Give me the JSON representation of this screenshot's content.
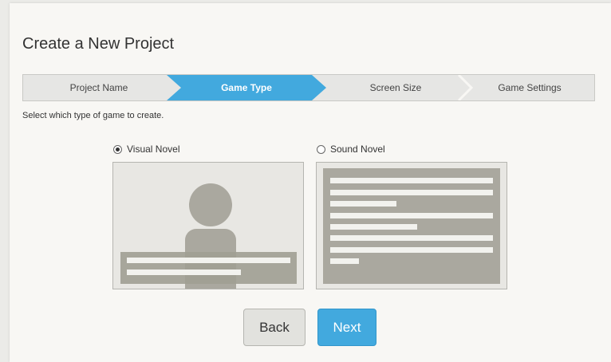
{
  "title": "Create a New Project",
  "wizard": {
    "steps": [
      {
        "label": "Project Name"
      },
      {
        "label": "Game Type"
      },
      {
        "label": "Screen Size"
      },
      {
        "label": "Game Settings"
      }
    ],
    "active_step": "Game Type"
  },
  "instruction": "Select which type of game to create.",
  "options": [
    {
      "label": "Visual Novel",
      "selected": true
    },
    {
      "label": "Sound Novel",
      "selected": false
    }
  ],
  "buttons": {
    "back": "Back",
    "next": "Next"
  },
  "colors": {
    "accent": "#42a9de",
    "panel_bg": "#f8f7f4",
    "preview_shape": "#aaa89f"
  }
}
